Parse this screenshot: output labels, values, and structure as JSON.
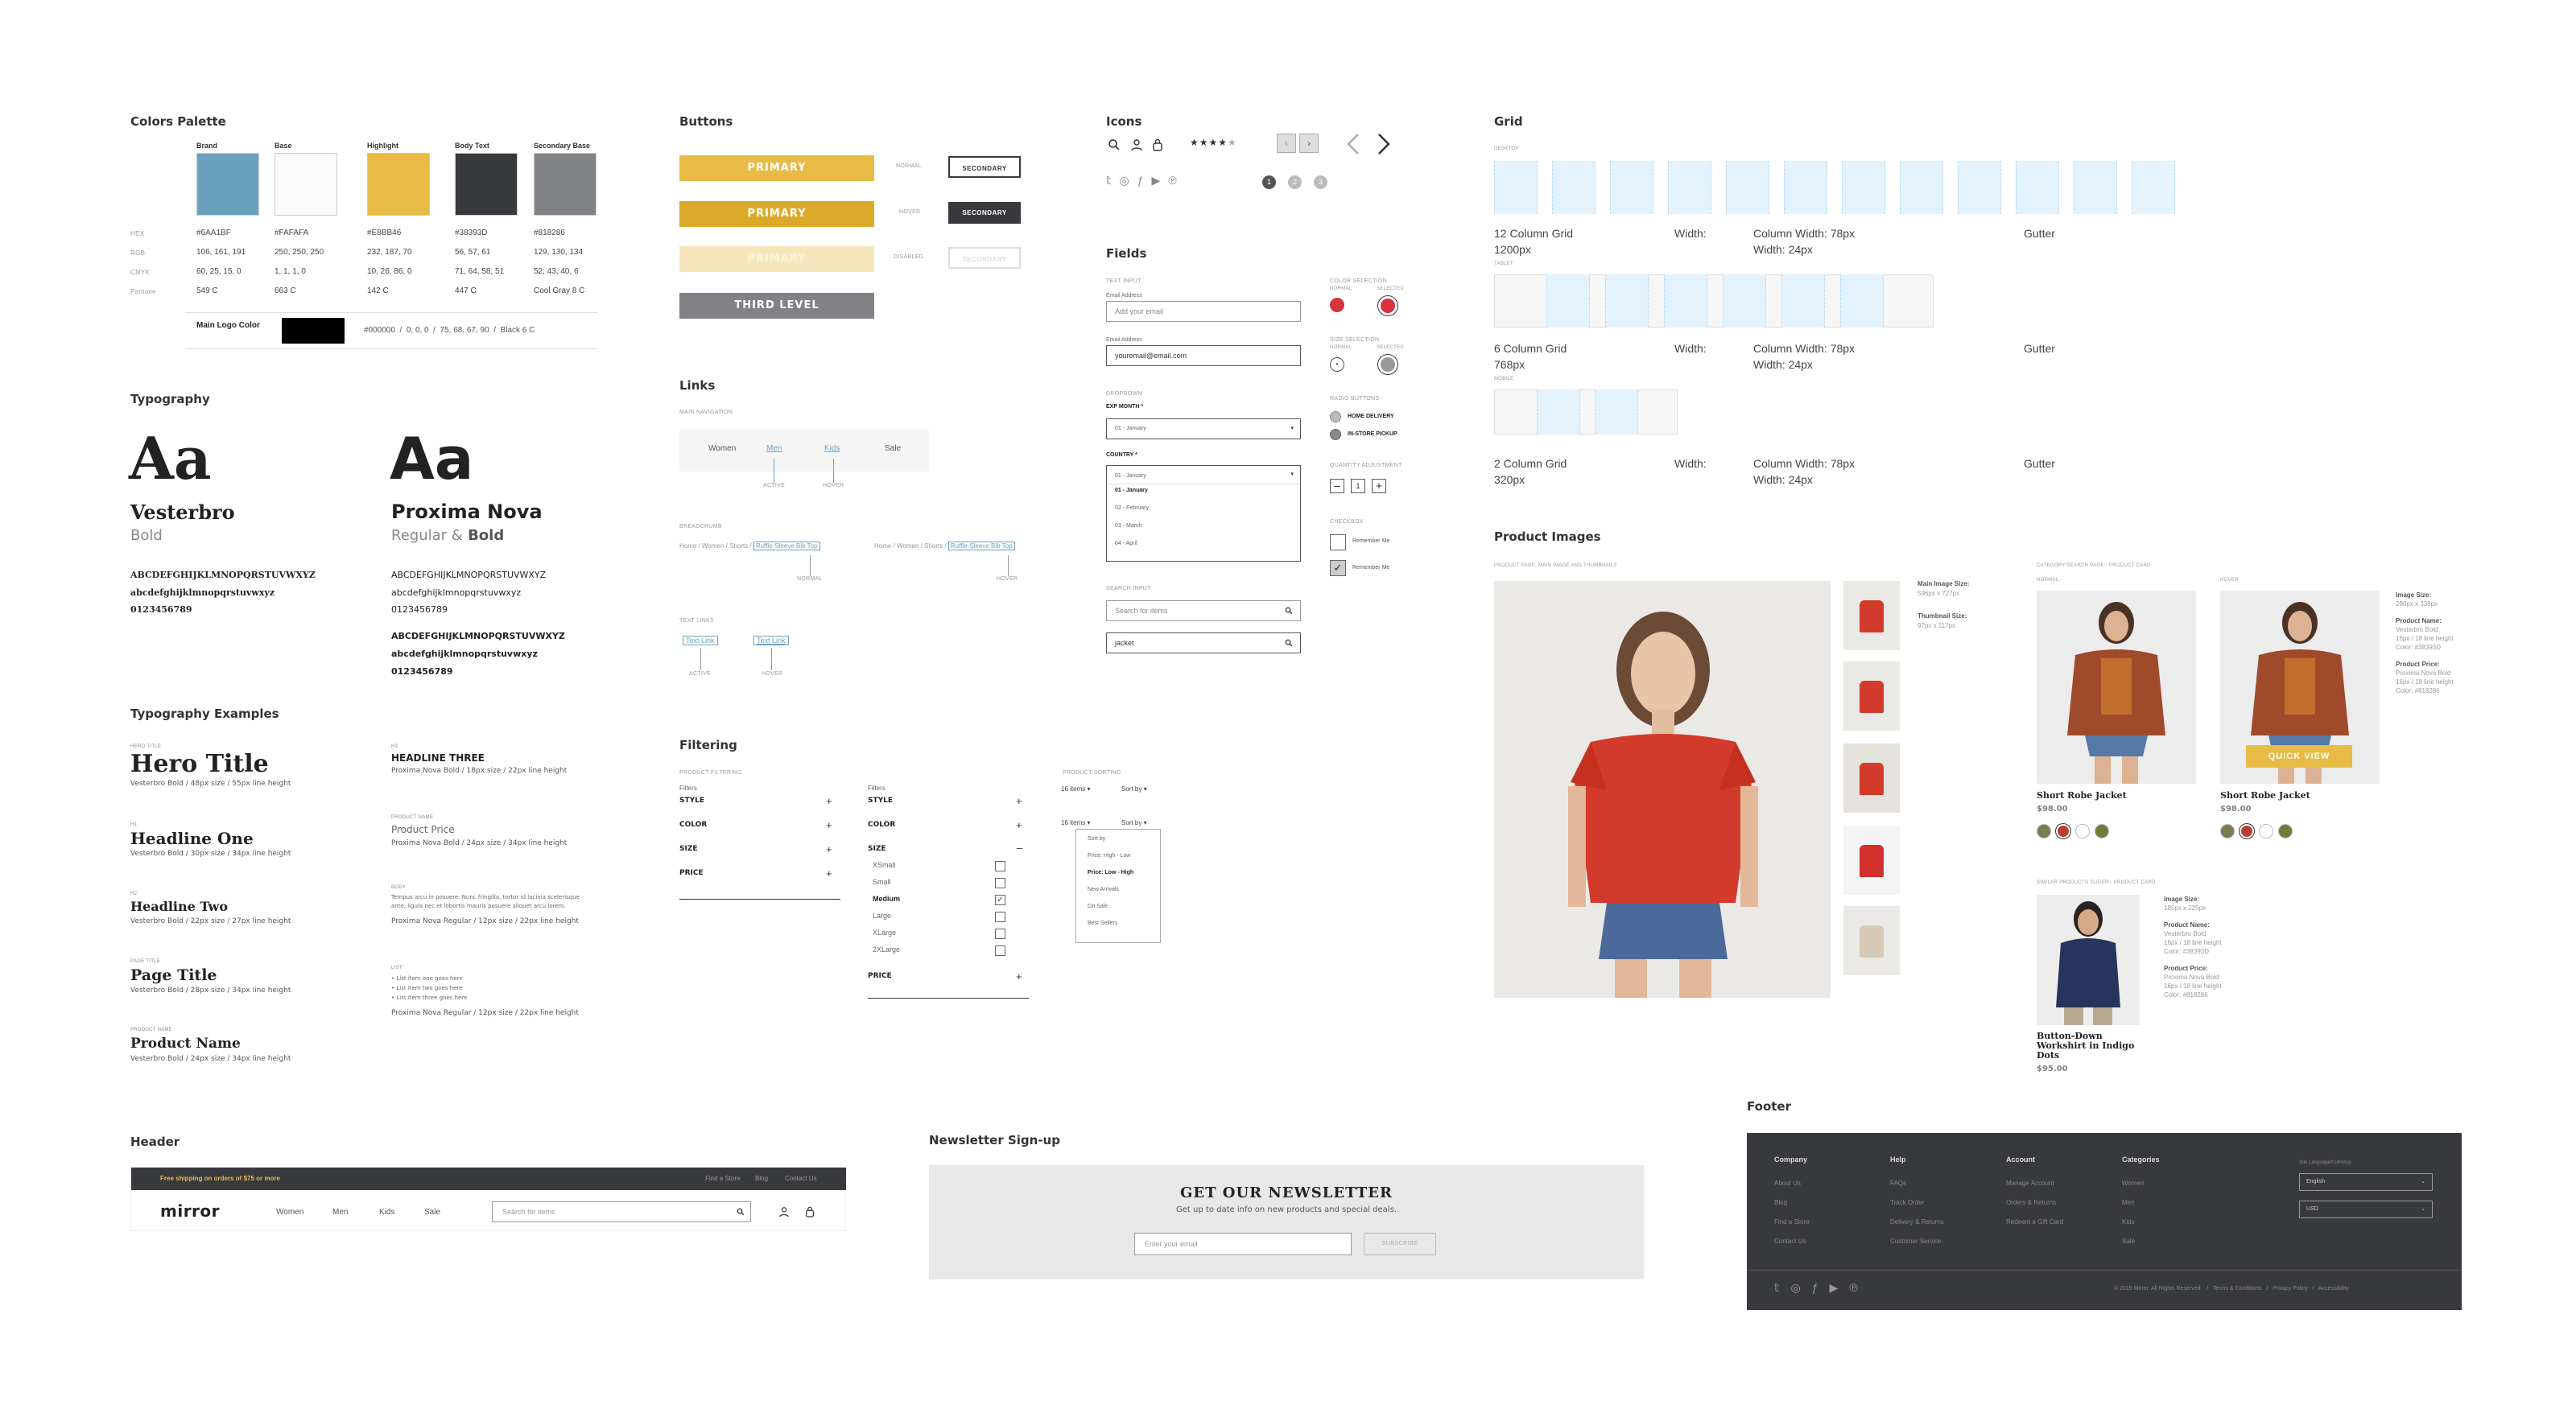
{
  "colors": {
    "title": "Colors Palette",
    "swatches": [
      {
        "name": "Brand",
        "hex": "#6AA1BF",
        "rgb": "106, 161, 191",
        "cmyk": "60, 25, 15, 0",
        "pantone": "549 C",
        "color": "#6AA1BF"
      },
      {
        "name": "Base",
        "hex": "#FAFAFA",
        "rgb": "250, 250, 250",
        "cmyk": "1, 1, 1, 0",
        "pantone": "663 C",
        "color": "#FAFAFA"
      },
      {
        "name": "Highlight",
        "hex": "#E8BB46",
        "rgb": "232, 187, 70",
        "cmyk": "10, 26, 86, 0",
        "pantone": "142 C",
        "color": "#E8BB46"
      },
      {
        "name": "Body Text",
        "hex": "#38393D",
        "rgb": "56, 57, 61",
        "cmyk": "71, 64, 58, 51",
        "pantone": "447 C",
        "color": "#38393D"
      },
      {
        "name": "Secondary Base",
        "hex": "#818286",
        "rgb": "129, 130, 134",
        "cmyk": "52, 43, 40, 6",
        "pantone": "Cool Gray 8 C",
        "color": "#818286"
      }
    ],
    "row_labels": [
      "HEX",
      "RGB",
      "CMYK",
      "Pantone"
    ],
    "logo_label": "Main Logo Color",
    "logo_values": "#000000  /  0, 0, 0  /  75, 68, 67, 90  /  Black 6 C"
  },
  "typography": {
    "title": "Typography",
    "serif": {
      "sample": "Aa",
      "name": "Vesterbro",
      "weight": "Bold",
      "upper": "ABCDEFGHIJKLMNOPQRSTUVWXYZ",
      "lower": "abcdefghijklmnopqrstuvwxyz",
      "nums": "0123456789"
    },
    "sans": {
      "sample": "Aa",
      "name": "Proxima Nova",
      "weight_a": "Regular &",
      "weight_b": " Bold",
      "upper": "ABCDEFGHIJKLMNOPQRSTUVWXYZ",
      "lower": "abcdefghijklmnopqrstuvwxyz",
      "nums": "0123456789"
    }
  },
  "tyex": {
    "title": "Typography Examples",
    "left": [
      {
        "lbl": "Hero Title",
        "text": "Hero Title",
        "meta": "Vesterbro Bold  /  48px size  /  55px line height"
      },
      {
        "lbl": "H1",
        "text": "Headline One",
        "meta": "Vesterbro Bold  /  30px size  /  34px line height"
      },
      {
        "lbl": "H2",
        "text": "Headline Two",
        "meta": "Vesterbro Bold  /  22px size  /  27px line height"
      },
      {
        "lbl": "Page Title",
        "text": "Page Title",
        "meta": "Vesterbro Bold  /  28px size  /  34px line height"
      },
      {
        "lbl": "Product Name",
        "text": "Product Name",
        "meta": "Vesterbro Bold  /  24px size  /  34px line height"
      }
    ],
    "right": [
      {
        "lbl": "H3",
        "text": "HEADLINE THREE",
        "meta": "Proxima Nova Bold  /  18px size  /  22px line height"
      },
      {
        "lbl": "Product Name",
        "text": "Product Price",
        "meta": "Proxima Nova Bold  /  24px size  /  34px line height"
      },
      {
        "lbl": "Body",
        "text": "Tempus arcu in posuere. Nunc fringilla, tortor id lacinia scelerisque ante, ligula nec et lobortis mauris posuere aliquet arcu lorem.",
        "meta": "Proxima Nova Regular  /  12px size  /  22px line height"
      },
      {
        "lbl": "List",
        "items": [
          "• List item one goes here",
          "• List item two goes here",
          "• List item three goes here"
        ],
        "meta": "Proxima Nova Regular  /  12px size  /  22px line height"
      }
    ]
  },
  "buttons": {
    "title": "Buttons",
    "primary": "PRIMARY",
    "secondary": "SECONDARY",
    "third": "THIRD LEVEL",
    "states": [
      "NORMAL",
      "HOVER",
      "DISABLED"
    ]
  },
  "links": {
    "title": "Links",
    "main_nav": "Main Navigation",
    "nav": [
      "Women",
      "Men",
      "Kids",
      "Sale"
    ],
    "active": "ACTIVE",
    "hover": "HOVER",
    "breadcrumb": "Breadcrumb",
    "crumbs": [
      "Home",
      "Women",
      "Shorts",
      "Ruffle-Sleeve Bib Top"
    ],
    "normal": "NORMAL",
    "text_links": "Text Links",
    "text_link": "Text Link"
  },
  "icons": {
    "title": "Icons",
    "pages": [
      "1",
      "2",
      "3"
    ]
  },
  "fields": {
    "title": "Fields",
    "text_input": "Text Input",
    "email_label": "Email Address",
    "email_ph": "Add your email",
    "email_val": "youremail@email.com",
    "dropdown": "Dropdown",
    "exp": "EXP MONTH *",
    "exp_val": "01 - January",
    "country": "COUNTRY *",
    "months": [
      "01 - January",
      "02 - February",
      "03 - March",
      "04 - April"
    ],
    "search_input": "Search Input",
    "search_ph": "Search for items",
    "search_val": "jacket",
    "color_sel": "Color Selection",
    "size_sel": "Size Selection",
    "normal": "NORMAL",
    "selected": "SELECTED",
    "radio": "Radio Buttons",
    "home": "HOME DELIVERY",
    "store": "IN-STORE PICKUP",
    "qty": "Quantity Adjustment",
    "qty_val": "1",
    "checkbox": "Checkbox",
    "remember": "Remember Me"
  },
  "filtering": {
    "title": "Filtering",
    "product_filtering": "Product Filtering",
    "filters": "Filters",
    "style": "STYLE",
    "color": "COLOR",
    "size": "SIZE",
    "price": "PRICE",
    "sizes": [
      "XSmall",
      "Small",
      "Medium",
      "Large",
      "XLarge",
      "2XLarge"
    ],
    "product_sorting": "Product Sorting",
    "items": "16 items",
    "sort": "Sort by",
    "sort_opts": [
      "Sort by",
      "Price: High - Low",
      "Price: Low - High",
      "New Arrivals",
      "On Sale",
      "Best Sellers"
    ]
  },
  "grid": {
    "title": "Grid",
    "desktop": "Desktop",
    "tablet": "Tablet",
    "mobile": "Mobile",
    "rows": [
      {
        "name": "12 Column Grid",
        "size": "1200px",
        "width": "Width:",
        "colw": "Column Width: 78px",
        "gw": "Width: 24px",
        "gutter": "Gutter"
      },
      {
        "name": "6 Column Grid",
        "size": "768px",
        "width": "Width:",
        "colw": "Column Width: 78px",
        "gw": "Width: 24px",
        "gutter": "Gutter"
      },
      {
        "name": "2 Column Grid",
        "size": "320px",
        "width": "Width:",
        "colw": "Column Width: 78px",
        "gw": "Width: 24px",
        "gutter": "Gutter"
      }
    ]
  },
  "images": {
    "title": "Product Images",
    "pp_label": "Product Page: Main Image and Thumbnails",
    "main_size": "Main Image Size:",
    "main_dim": "596px x 727px",
    "thumb_size": "Thumbnail Size:",
    "thumb_dim": "97px x 117px",
    "cat_label": "Category/Search Page - Product Card",
    "normal": "Normal",
    "hover": "Hover",
    "product": "Short Robe Jacket",
    "price": "$98.00",
    "quick": "QUICK VIEW",
    "card_size": "Image Size:",
    "card_dim": "290px x 338px",
    "pn": "Product Name:",
    "pn1": "Vesterbro Bold",
    "pn2": "16px  /  18 line height",
    "pn3": "Color: #38393D",
    "pp": "Product Price:",
    "pp1": "Proxima Nova Bold",
    "pp2": "16px  /  18 line height",
    "pp3": "Color: #818286",
    "slider_label": "Similar Products Slider - Product Card",
    "slider_size": "Image Size:",
    "slider_dim": "185px x 225px",
    "slider_name": "Button-Down Workshirt in Indigo Dots",
    "slider_price": "$95.00",
    "sp3": "Color: #38393D",
    "sp6": "Color: #818286",
    "swatch_colors": [
      "#7b7a52",
      "#b5402f",
      "#ffffff",
      "#6f7d3a"
    ]
  },
  "header": {
    "title": "Header",
    "promo": "Free shipping on orders of $75 or more",
    "util": [
      "Find a Store",
      "Blog",
      "Contact Us"
    ],
    "logo": "mirror",
    "nav": [
      "Women",
      "Men",
      "Kids",
      "Sale"
    ],
    "search": "Search for items"
  },
  "newsletter": {
    "title": "Newsletter Sign-up",
    "heading": "GET OUR NEWSLETTER",
    "sub": "Get up to date info on new products and special deals.",
    "ph": "Enter your email",
    "btn": "SUBSCRIBE"
  },
  "footer": {
    "title": "Footer",
    "cols": [
      {
        "h": "Company",
        "items": [
          "About Us",
          "Blog",
          "Find a Store",
          "Contact Us"
        ]
      },
      {
        "h": "Help",
        "items": [
          "FAQs",
          "Track Order",
          "Delivery & Returns",
          "Customer Service"
        ]
      },
      {
        "h": "Account",
        "items": [
          "Manage Account",
          "Orders & Returns",
          "Redeem a Gift Card"
        ]
      },
      {
        "h": "Categories",
        "items": [
          "Women",
          "Men",
          "Kids",
          "Sale"
        ]
      }
    ],
    "lang_label": "Site Language/Currency",
    "lang": "English",
    "cur": "USD",
    "copy": "© 2019 Mirror. All Rights Reserved.   /   Terms & Conditions   /   Privacy Policy   /   Accessibility"
  }
}
